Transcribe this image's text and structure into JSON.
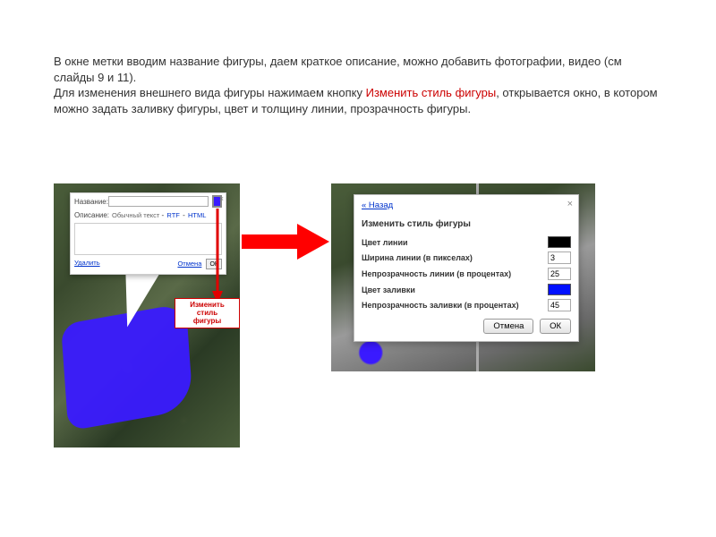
{
  "intro": {
    "line1": "В окне метки вводим название фигуры, даем краткое описание, можно добавить фотографии, видео (см слайды 9 и 11).",
    "line2_a": "Для изменения внешнего вида фигуры нажимаем кнопку ",
    "line2_red": "Изменить стиль фигуры",
    "line2_b": ", открывается окно, в котором можно задать заливку фигуры, цвет и толщину линии, прозрачность фигуры."
  },
  "left_popup": {
    "name_label": "Название:",
    "desc_label": "Описание:",
    "mode_plain": "Обычный текст",
    "mode_rtf": "RTF",
    "mode_html": "HTML",
    "delete": "Удалить",
    "cancel": "Отмена",
    "ok": "ОК",
    "close": "×"
  },
  "red_label": {
    "l1": "Изменить стиль",
    "l2": "фигуры"
  },
  "right_popup": {
    "back": "« Назад",
    "close": "×",
    "title": "Изменить стиль фигуры",
    "rows": {
      "line_color": "Цвет линии",
      "line_width": "Ширина линии (в пикселах)",
      "line_opacity": "Непрозрачность линии (в процентах)",
      "fill_color": "Цвет заливки",
      "fill_opacity": "Непрозрачность заливки (в процентах)"
    },
    "values": {
      "line_width": "3",
      "line_opacity": "25",
      "fill_opacity": "45"
    },
    "cancel": "Отмена",
    "ok": "ОК"
  }
}
